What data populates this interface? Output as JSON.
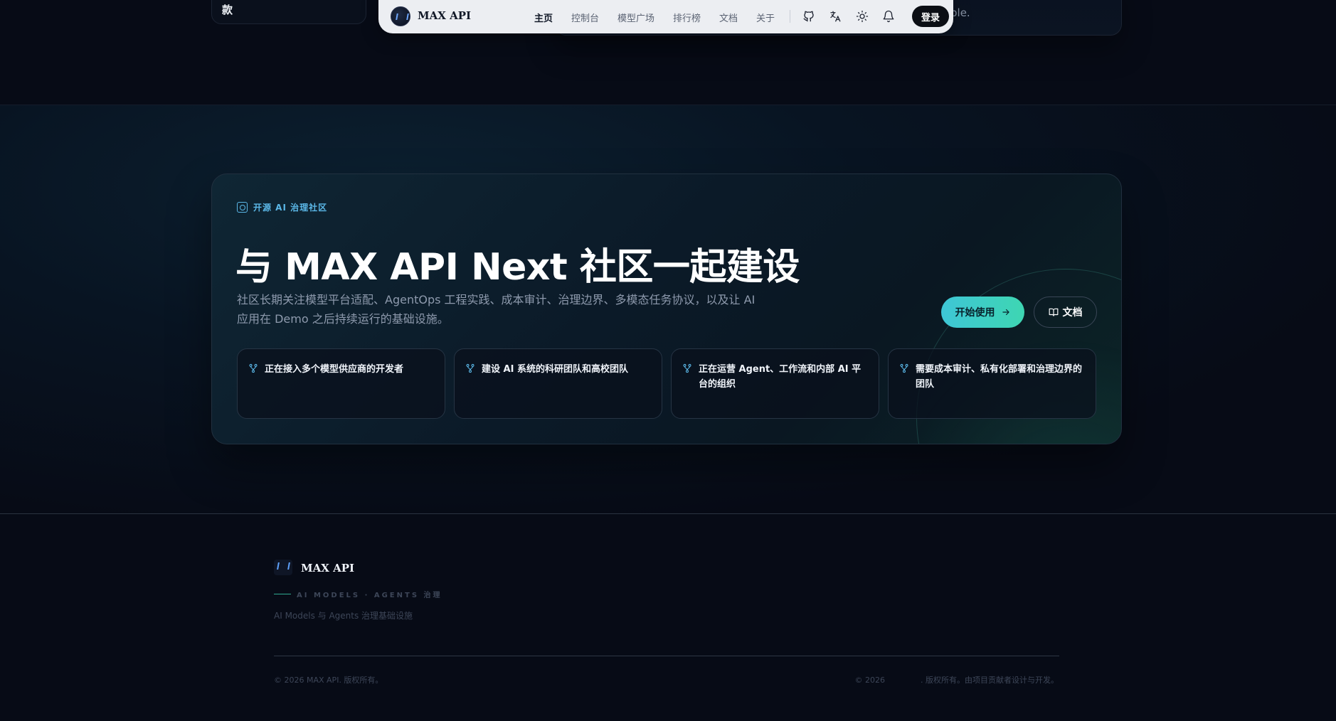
{
  "prev_section": {
    "left_card_text": "款",
    "right_card_text": "ble."
  },
  "navbar": {
    "brand": "MAX API",
    "links": [
      "主页",
      "控制台",
      "模型广场",
      "排行榜",
      "文档",
      "关于"
    ],
    "active_link": "主页",
    "icons": [
      "github-icon",
      "translate-icon",
      "sun-icon",
      "bell-icon"
    ],
    "login_label": "登录"
  },
  "community": {
    "eyebrow": "开源 AI 治理社区",
    "headline": "与 MAX API Next 社区一起建设",
    "subtitle": "社区长期关注模型平台适配、AgentOps 工程实践、成本审计、治理边界、多模态任务协议，以及让 AI 应用在 Demo 之后持续运行的基础设施。",
    "primary_button": "开始使用",
    "secondary_button": "文档",
    "features": [
      "正在接入多个模型供应商的开发者",
      "建设 AI 系统的科研团队和高校团队",
      "正在运营 Agent、工作流和内部 AI 平台的组织",
      "需要成本审计、私有化部署和治理边界的团队"
    ]
  },
  "footer": {
    "brand": "MAX API",
    "tagline": "AI MODELS · AGENTS 治理",
    "description": "AI Models 与 Agents 治理基础设施",
    "copyright_left": "© 2026 MAX API. 版权所有。",
    "copyright_right_prefix": "© 2026",
    "copyright_right_suffix": ". 版权所有。由项目贡献者设计与开发。"
  },
  "colors": {
    "background": "#070b16",
    "accent_cyan": "#5bb8e8",
    "button_gradient_start": "#3ec6d6",
    "button_gradient_end": "#3ed6b2",
    "navbar_bg": "#eceef2"
  }
}
